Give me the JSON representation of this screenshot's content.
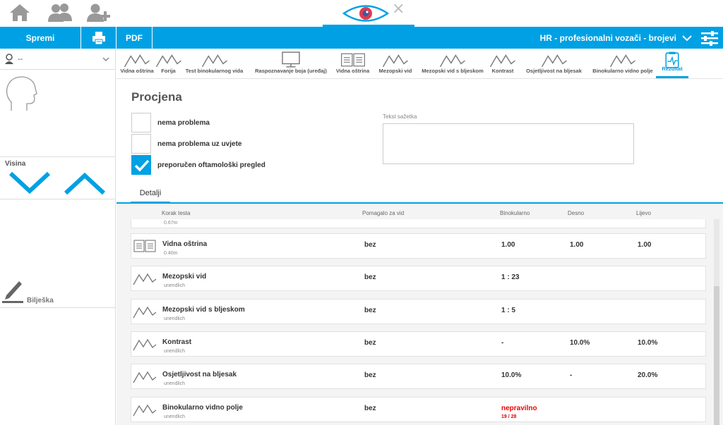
{
  "topbar": {
    "home_icon": "home-icon",
    "users_icon": "users-icon",
    "add_user_icon": "add-user-icon",
    "app_icon": "eye-icon",
    "close_icon": "close-icon",
    "close_glyph": "×"
  },
  "toolbar": {
    "save_label": "Spremi",
    "print_icon": "printer-icon",
    "pdf_label": "PDF",
    "profile_title": "HR - profesionalni vozači - brojevi",
    "menu_icon": "settings-sliders-icon"
  },
  "sidebar": {
    "user_value": "--",
    "height_label": "Visina",
    "note_label": "Bilješka"
  },
  "tabs": [
    {
      "label": "Vidna oštrina",
      "icon": "mountain-icon"
    },
    {
      "label": "Forija",
      "icon": "mountain-icon"
    },
    {
      "label": "Test binokularnog vida",
      "icon": "mountain-icon"
    },
    {
      "label": "Raspoznavanje boja (uređaj)",
      "icon": "monitor-icon"
    },
    {
      "label": "Vidna oštrina",
      "icon": "book-icon"
    },
    {
      "label": "Mezopski vid",
      "icon": "mountain-icon"
    },
    {
      "label": "Mezopski vid s bljeskom",
      "icon": "mountain-icon"
    },
    {
      "label": "Kontrast",
      "icon": "mountain-icon"
    },
    {
      "label": "Osjetljivost na bljesak",
      "icon": "mountain-icon"
    },
    {
      "label": "Binokularno vidno polje",
      "icon": "mountain-icon"
    },
    {
      "label": "Rezultat",
      "icon": "clipboard-icon",
      "active": true
    }
  ],
  "evaluation": {
    "title": "Procjena",
    "options": [
      {
        "label": "nema problema",
        "checked": false
      },
      {
        "label": "nema problema uz uvjete",
        "checked": false
      },
      {
        "label": "preporučen oftamološki pregled",
        "checked": true
      }
    ],
    "summary_label": "Tekst sažetka",
    "summary_value": ""
  },
  "details": {
    "tab_label": "Detalji",
    "columns": {
      "step": "Korak testa",
      "aid": "Pomagalo za vid",
      "binocular": "Binokularno",
      "right": "Desno",
      "left": "Lijevo"
    },
    "partial_row_sub": "0.67m",
    "rows": [
      {
        "name": "Vidna oštrina",
        "sub": "0.40m",
        "aid": "bez",
        "binocular": "1.00",
        "binocular_sub": "",
        "right": "1.00",
        "left": "1.00",
        "icon": "book-icon",
        "alert": false
      },
      {
        "name": "Mezopski vid",
        "sub": "unendlich",
        "aid": "bez",
        "binocular": "1 : 23",
        "binocular_sub": "",
        "right": "",
        "left": "",
        "icon": "mountain-icon",
        "alert": false
      },
      {
        "name": "Mezopski vid s bljeskom",
        "sub": "unendlich",
        "aid": "bez",
        "binocular": "1 : 5",
        "binocular_sub": "",
        "right": "",
        "left": "",
        "icon": "mountain-icon",
        "alert": false
      },
      {
        "name": "Kontrast",
        "sub": "unendlich",
        "aid": "bez",
        "binocular": "-",
        "binocular_sub": "",
        "right": "10.0%",
        "left": "10.0%",
        "icon": "mountain-icon",
        "alert": false
      },
      {
        "name": "Osjetljivost na bljesak",
        "sub": "unendlich",
        "aid": "bez",
        "binocular": "10.0%",
        "binocular_sub": "",
        "right": "-",
        "left": "20.0%",
        "icon": "mountain-icon",
        "alert": false
      },
      {
        "name": "Binokularno vidno polje",
        "sub": "unendlich",
        "aid": "bez",
        "binocular": "nepravilno",
        "binocular_sub": "19 / 28",
        "right": "",
        "left": "",
        "icon": "mountain-icon",
        "alert": true
      }
    ]
  },
  "colors": {
    "accent": "#00a1e4",
    "alert": "#e00000"
  }
}
